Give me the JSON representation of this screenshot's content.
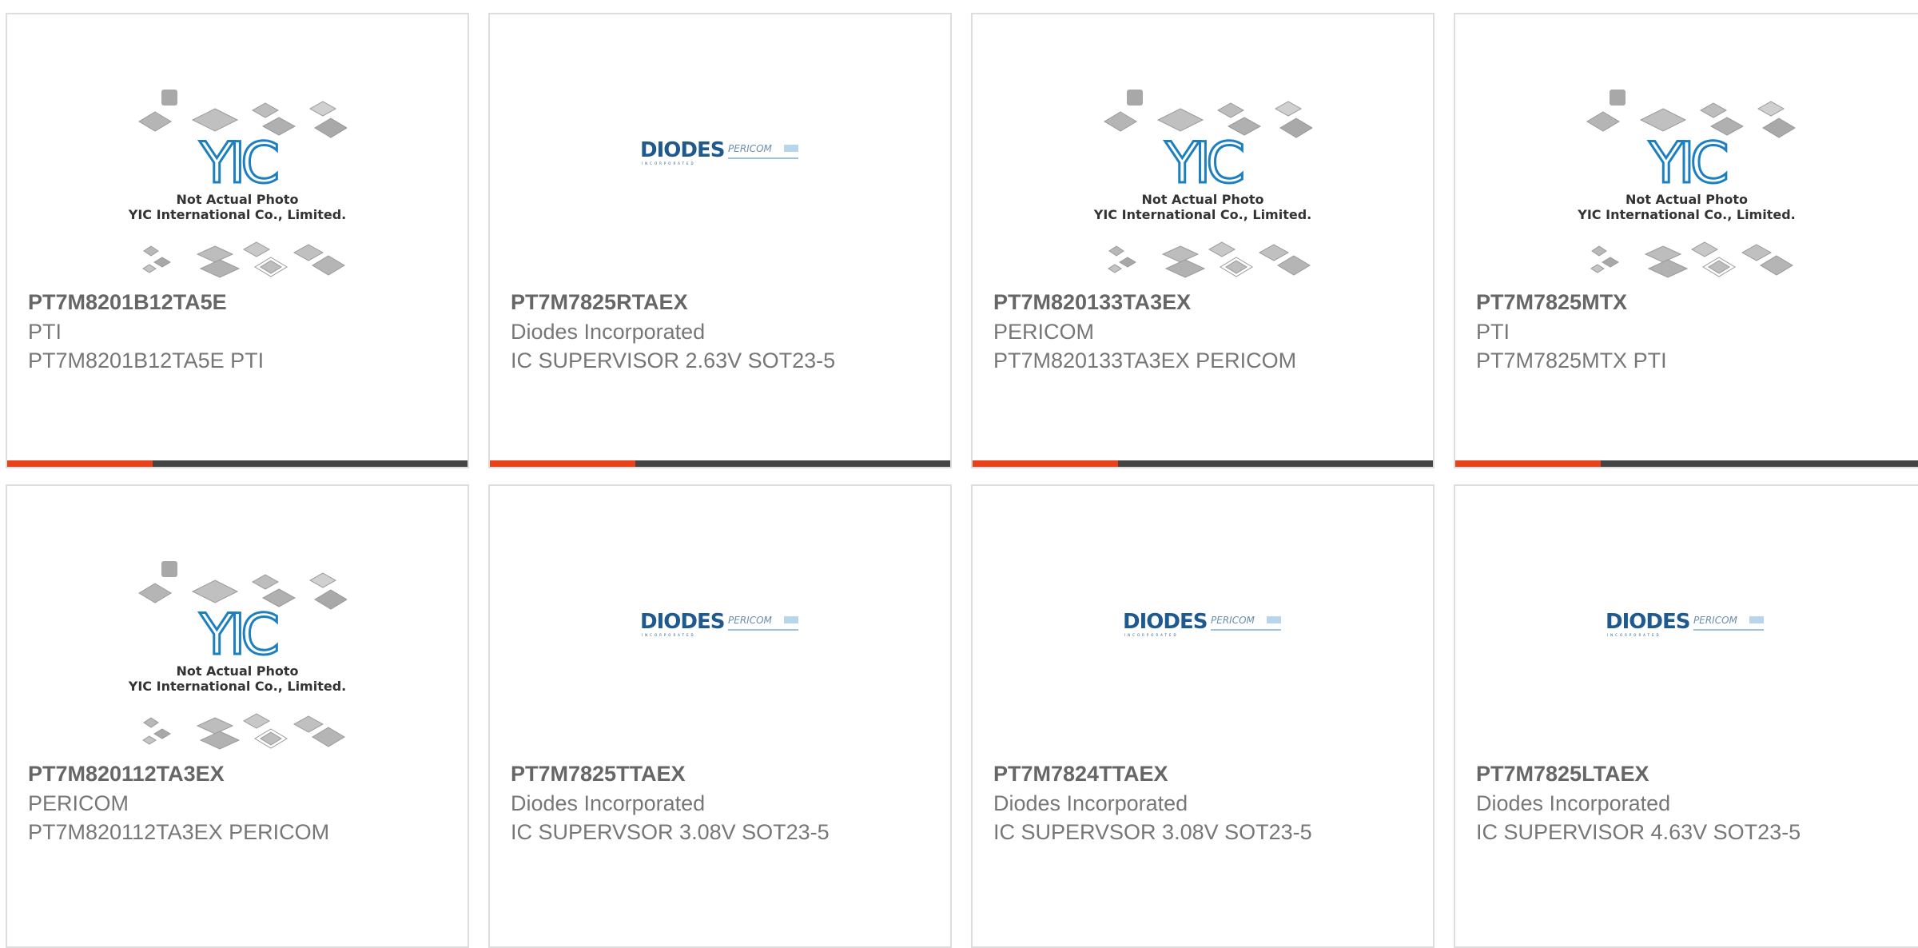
{
  "accent_color": "#e8421b",
  "bar_color": "#444444",
  "yic_placeholder": {
    "caption_line1": "Not Actual Photo",
    "caption_line2": "YIC International Co., Limited.",
    "logo_text": "YIC"
  },
  "diodes_logo": {
    "brand": "DIODES",
    "brand_sub": "INCORPORATED",
    "partner": "PERICOM"
  },
  "products": [
    {
      "part_number": "PT7M8201B12TA5E",
      "manufacturer": "PTI",
      "description": "PT7M8201B12TA5E PTI",
      "image": "yic-placeholder"
    },
    {
      "part_number": "PT7M7825RTAEX",
      "manufacturer": "Diodes Incorporated",
      "description": "IC SUPERVISOR 2.63V SOT23-5",
      "image": "diodes-logo"
    },
    {
      "part_number": "PT7M820133TA3EX",
      "manufacturer": "PERICOM",
      "description": "PT7M820133TA3EX PERICOM",
      "image": "yic-placeholder"
    },
    {
      "part_number": "PT7M7825MTX",
      "manufacturer": "PTI",
      "description": "PT7M7825MTX PTI",
      "image": "yic-placeholder"
    },
    {
      "part_number": "PT7M820112TA3EX",
      "manufacturer": "PERICOM",
      "description": "PT7M820112TA3EX PERICOM",
      "image": "yic-placeholder"
    },
    {
      "part_number": "PT7M7825TTAEX",
      "manufacturer": "Diodes Incorporated",
      "description": "IC SUPERVSOR 3.08V SOT23-5",
      "image": "diodes-logo"
    },
    {
      "part_number": "PT7M7824TTAEX",
      "manufacturer": "Diodes Incorporated",
      "description": "IC SUPERVSOR 3.08V SOT23-5",
      "image": "diodes-logo"
    },
    {
      "part_number": "PT7M7825LTAEX",
      "manufacturer": "Diodes Incorporated",
      "description": "IC SUPERVISOR 4.63V SOT23-5",
      "image": "diodes-logo"
    }
  ]
}
